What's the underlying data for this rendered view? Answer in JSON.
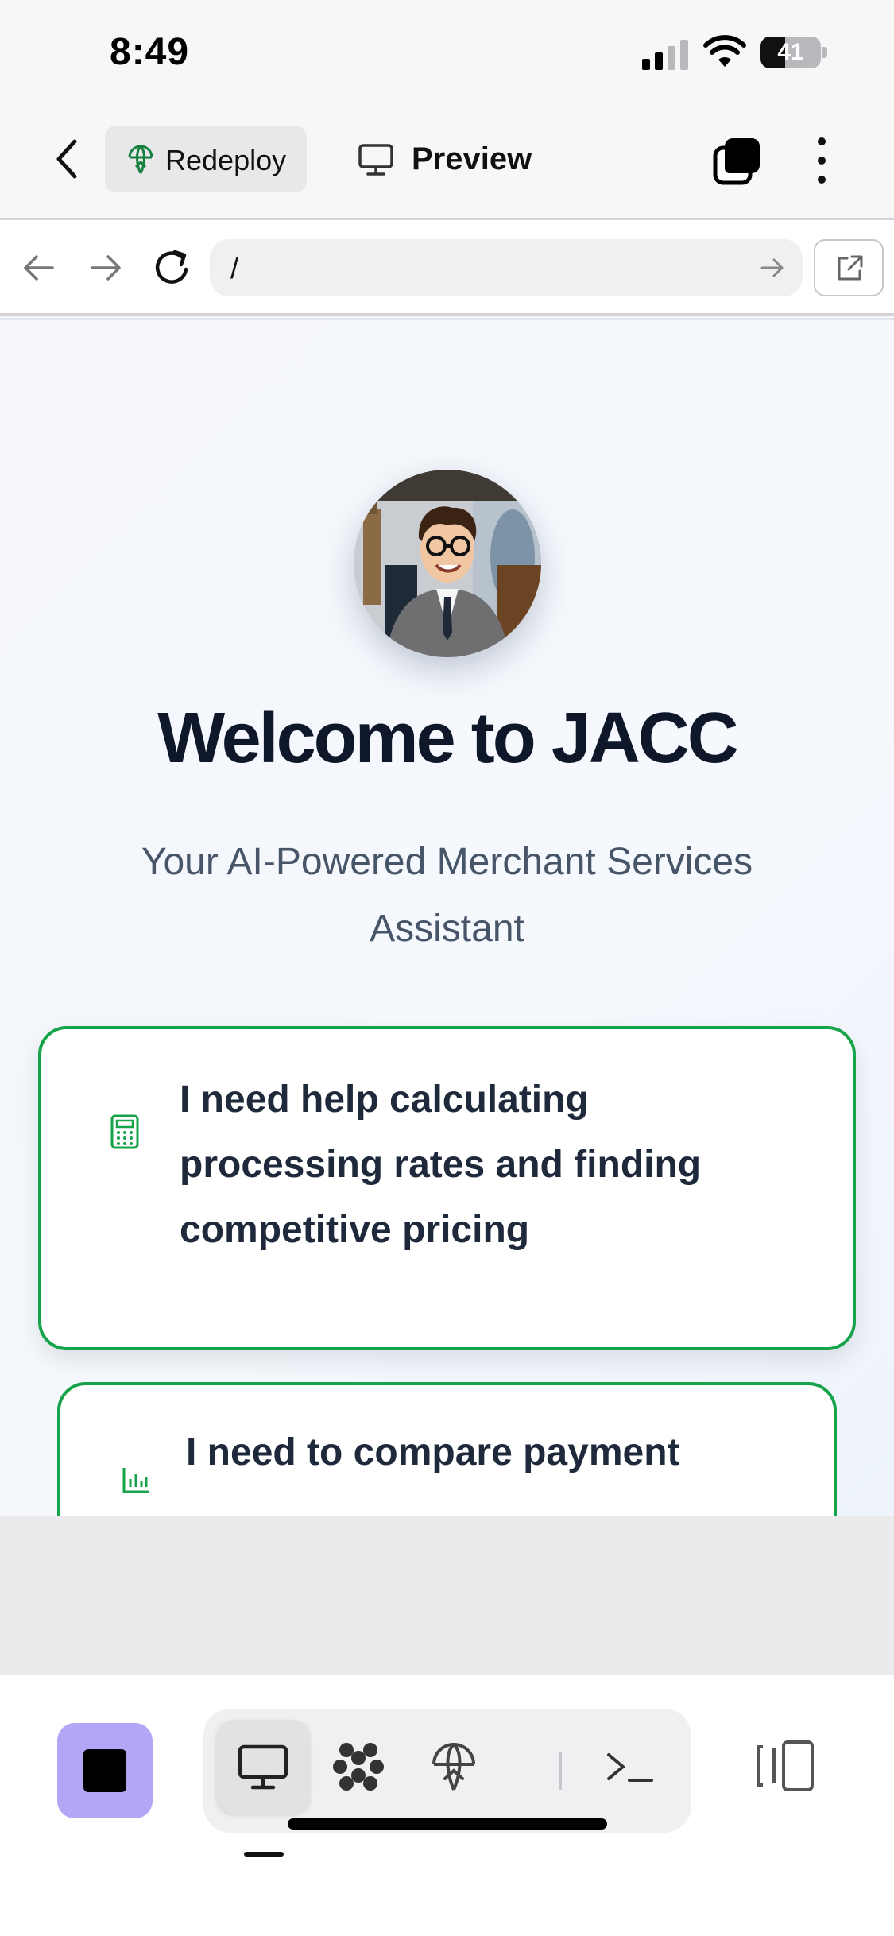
{
  "status_bar": {
    "time": "8:49",
    "battery": "41",
    "battery_level": 0.41
  },
  "toolbar": {
    "redeploy_label": "Redeploy",
    "preview_label": "Preview"
  },
  "url_bar": {
    "url": "/"
  },
  "page": {
    "title": "Welcome to JACC",
    "subtitle": "Your AI-Powered Merchant Services Assistant",
    "cards": [
      {
        "text": "I need help calculating processing rates and finding competitive pricing",
        "icon": "calculator-icon"
      },
      {
        "text": "I need to compare payment",
        "icon": "bar-chart-icon"
      }
    ]
  },
  "colors": {
    "accent": "#16a34a",
    "stop_button": "#b4a6f7",
    "title": "#0f172a",
    "subtitle": "#475569"
  },
  "dock": {
    "items": [
      "preview-icon",
      "extensions-icon",
      "deploy-icon",
      "shell-icon"
    ]
  }
}
